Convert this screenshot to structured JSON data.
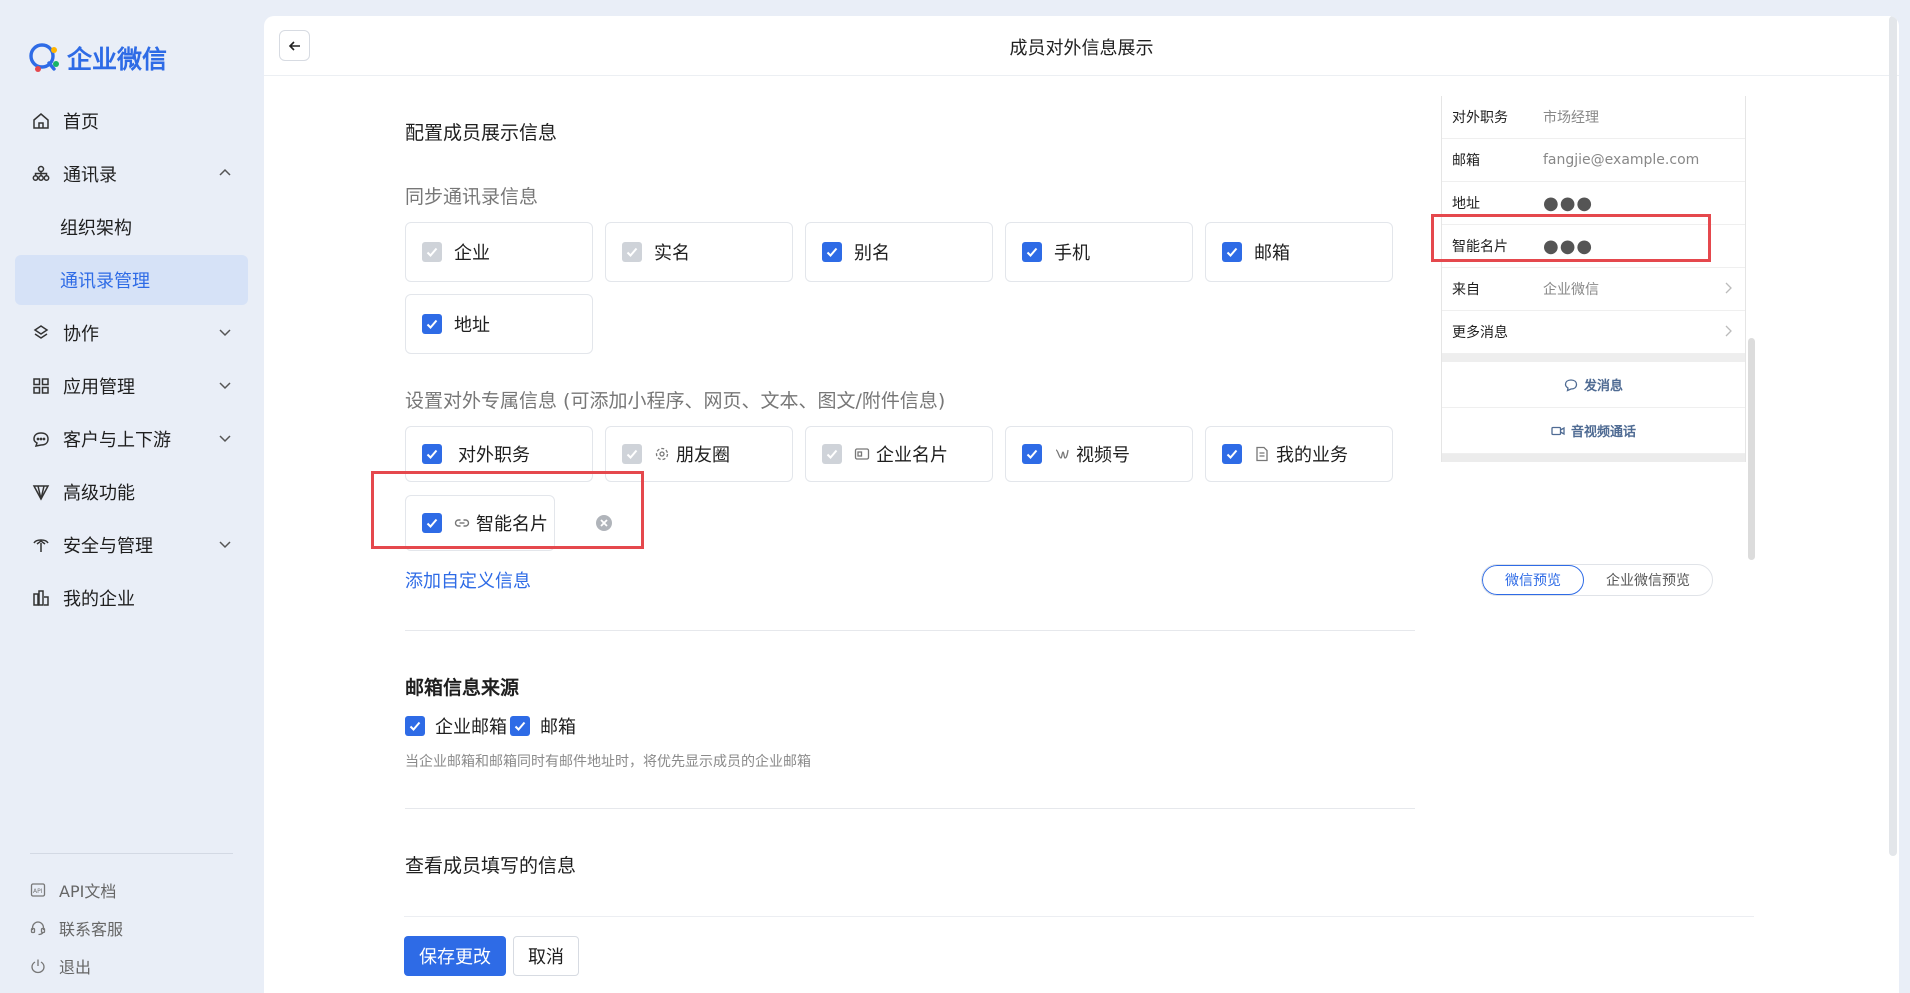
{
  "app": {
    "name": "企业微信"
  },
  "sidebar": {
    "items": [
      {
        "label": "首页",
        "icon": "home-icon"
      },
      {
        "label": "通讯录",
        "icon": "contacts-icon",
        "expanded": true
      },
      {
        "label": "组织架构"
      },
      {
        "label": "通讯录管理",
        "active": true
      },
      {
        "label": "协作",
        "icon": "collaborate-icon"
      },
      {
        "label": "应用管理",
        "icon": "apps-icon"
      },
      {
        "label": "客户与上下游",
        "icon": "customer-icon"
      },
      {
        "label": "高级功能",
        "icon": "advanced-icon"
      },
      {
        "label": "安全与管理",
        "icon": "security-icon"
      },
      {
        "label": "我的企业",
        "icon": "company-icon"
      }
    ],
    "footer": [
      {
        "label": "API文档",
        "icon": "api-icon"
      },
      {
        "label": "联系客服",
        "icon": "support-icon"
      },
      {
        "label": "退出",
        "icon": "logout-icon"
      }
    ]
  },
  "header": {
    "title": "成员对外信息展示"
  },
  "main": {
    "section_title": "配置成员展示信息",
    "sync": {
      "title": "同步通讯录信息",
      "options": [
        {
          "label": "企业",
          "state": "disabled"
        },
        {
          "label": "实名",
          "state": "disabled"
        },
        {
          "label": "别名",
          "state": "checked"
        },
        {
          "label": "手机",
          "state": "checked"
        },
        {
          "label": "邮箱",
          "state": "checked"
        },
        {
          "label": "地址",
          "state": "checked"
        }
      ]
    },
    "external": {
      "title": "设置对外专属信息 (可添加小程序、网页、文本、图文/附件信息)",
      "options": [
        {
          "label": "对外职务",
          "state": "checked"
        },
        {
          "label": "朋友圈",
          "state": "disabled",
          "icon": "moments-icon"
        },
        {
          "label": "企业名片",
          "state": "disabled",
          "icon": "card-icon"
        },
        {
          "label": "视频号",
          "state": "checked",
          "icon": "channels-icon"
        },
        {
          "label": "我的业务",
          "state": "checked",
          "icon": "document-icon"
        },
        {
          "label": "智能名片",
          "state": "checked",
          "icon": "link-icon"
        }
      ],
      "add_link": "添加自定义信息"
    },
    "mail": {
      "title": "邮箱信息来源",
      "option1": "企业邮箱",
      "option2": "邮箱",
      "hint": "当企业邮箱和邮箱同时有邮件地址时，将优先显示成员的企业邮箱"
    },
    "view": {
      "title": "查看成员填写的信息"
    }
  },
  "preview": {
    "rows": [
      {
        "key": "对外职务",
        "value": "市场经理"
      },
      {
        "key": "邮箱",
        "value": "fangjie@example.com"
      },
      {
        "key": "地址",
        "value": "●●●"
      },
      {
        "key": "智能名片",
        "value": "●●●"
      },
      {
        "key": "来自",
        "value": "企业微信"
      },
      {
        "key": "更多消息",
        "value": ""
      }
    ],
    "actions": [
      "发消息",
      "音视频通话"
    ],
    "tabs": [
      "微信预览",
      "企业微信预览"
    ]
  },
  "buttons": {
    "save": "保存更改",
    "cancel": "取消"
  },
  "colors": {
    "accent": "#2e6be6",
    "highlight": "#e5484d",
    "sidebar_bg": "#e9eef7"
  }
}
